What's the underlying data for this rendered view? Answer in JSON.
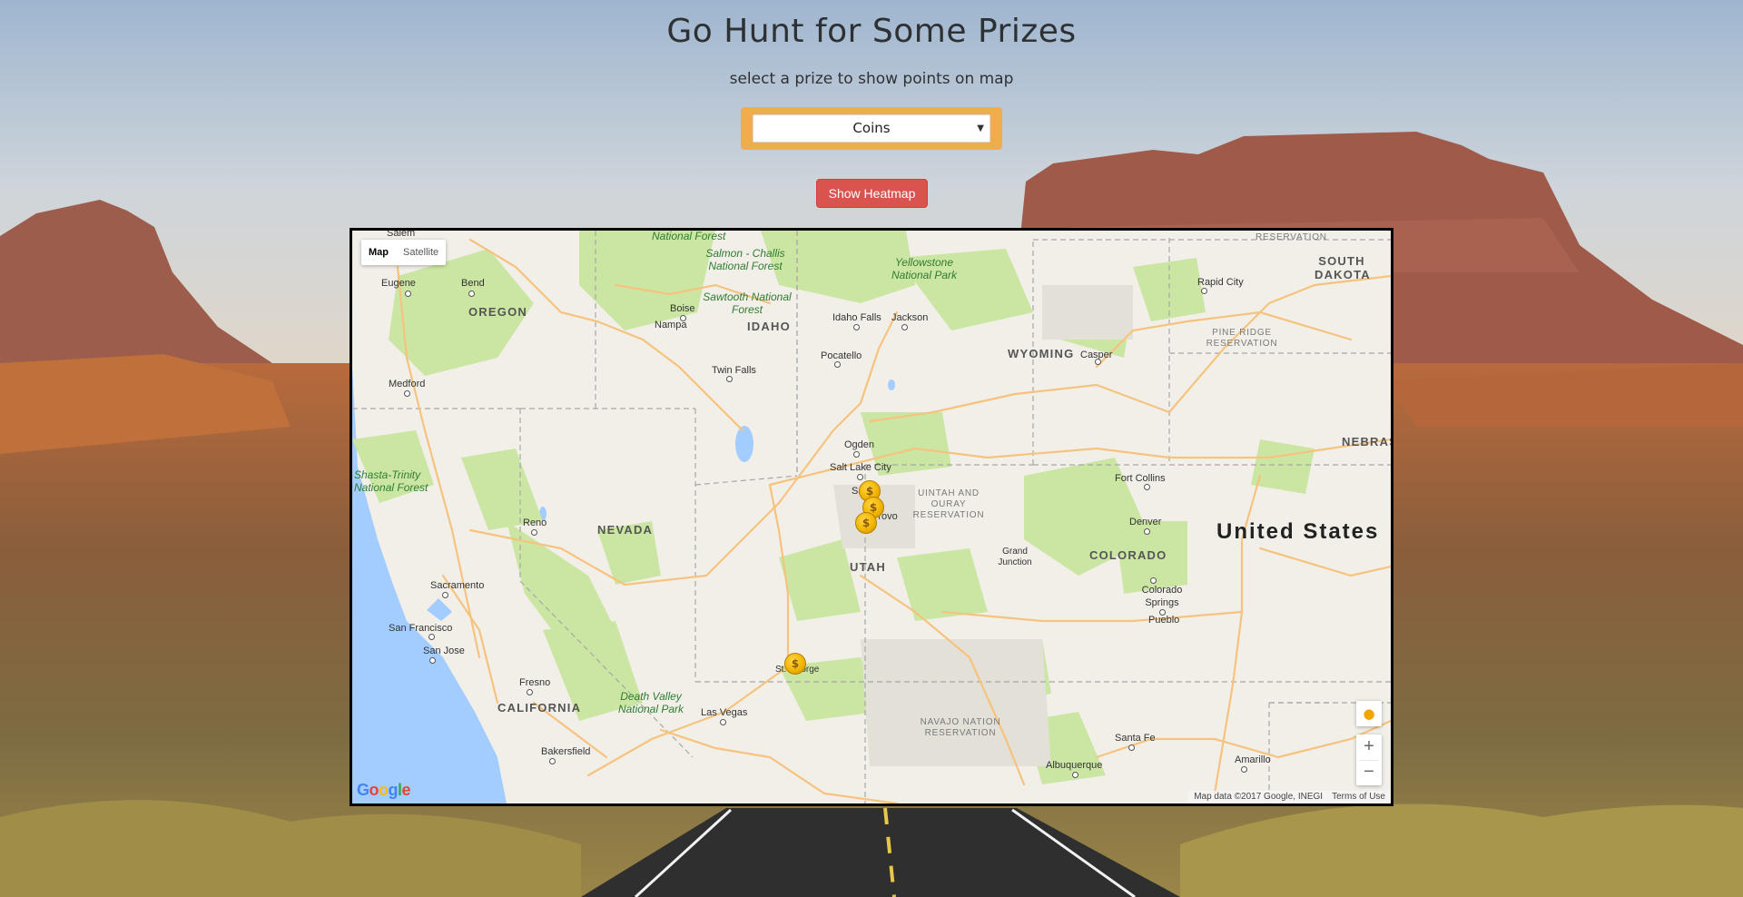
{
  "page": {
    "title": "Go Hunt for Some Prizes",
    "subtitle": "select a prize to show points on map"
  },
  "prize_select": {
    "selected": "Coins",
    "arrow_icon": "dropdown-triangle"
  },
  "heatmap_button": {
    "label": "Show Heatmap"
  },
  "map": {
    "type_control": {
      "map_label": "Map",
      "satellite_label": "Satellite",
      "active": "Map"
    },
    "country_label": "United States",
    "states": [
      "OREGON",
      "IDAHO",
      "WYOMING",
      "SOUTH DAKOTA",
      "NEBRAS",
      "NEVADA",
      "UTAH",
      "COLORADO",
      "CALIFORNIA"
    ],
    "cities": [
      "Salem",
      "Eugene",
      "Bend",
      "Medford",
      "Boise",
      "Nampa",
      "Twin Falls",
      "Pocatello",
      "Idaho Falls",
      "Jackson",
      "Casper",
      "Rapid City",
      "Ogden",
      "Salt Lake City",
      "Sa",
      "Provo",
      "Fort Collins",
      "Denver",
      "Grand Junction",
      "Colorado Springs",
      "Pueblo",
      "Reno",
      "Sacramento",
      "San Francisco",
      "San Jose",
      "Fresno",
      "Bakersfield",
      "Las Vegas",
      "St. George",
      "Santa Fe",
      "Albuquerque",
      "Amarillo"
    ],
    "parks": [
      "National Forest",
      "Salmon - Challis National Forest",
      "Sawtooth National Forest",
      "Yellowstone National Park",
      "Shasta-Trinity National Forest",
      "Death Valley National Park"
    ],
    "reservations": [
      "RESERVATION",
      "PINE RIDGE RESERVATION",
      "UINTAH AND OURAY RESERVATION",
      "NAVAJO NATION RESERVATION"
    ],
    "coin_markers": 4,
    "attribution": "Map data ©2017 Google, INEGI",
    "terms": "Terms of Use",
    "logo": "Google",
    "colors": {
      "water": "#a3ccff",
      "land": "#f2efe9",
      "park": "#cbe6a3",
      "road": "#f6c37e",
      "reservation": "#e3e0d8",
      "button_red": "#d9534f",
      "select_orange": "#efad4b",
      "coin_gold": "#f2b600"
    }
  }
}
